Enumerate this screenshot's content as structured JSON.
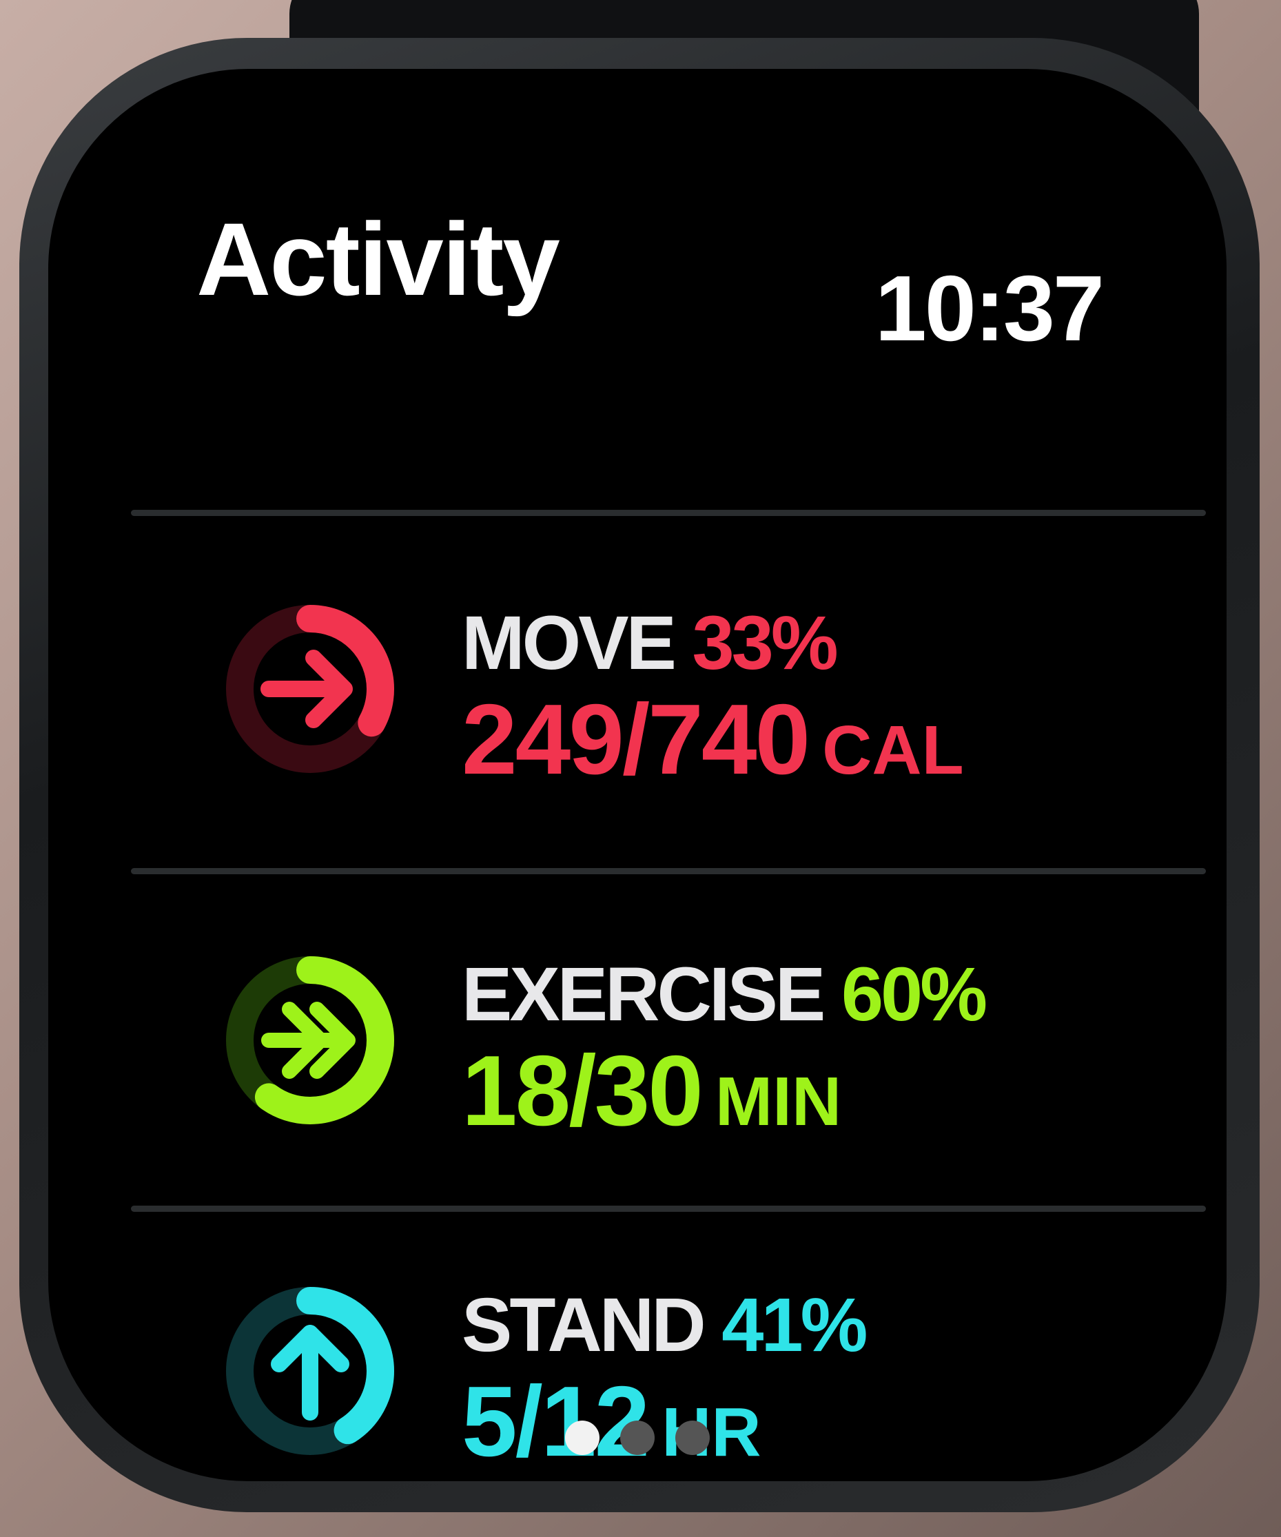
{
  "app": {
    "title": "Activity",
    "time": "10:37"
  },
  "rings": [
    {
      "name": "MOVE",
      "percent": "33%",
      "fraction": 0.33,
      "value": "249/740",
      "unit": "CAL",
      "color": "#f2344f",
      "track": "#3a0a12",
      "icon": "move-arrow-icon"
    },
    {
      "name": "EXERCISE",
      "percent": "60%",
      "fraction": 0.6,
      "value": "18/30",
      "unit": "MIN",
      "color": "#9ef21a",
      "track": "#1d3b06",
      "icon": "exercise-double-arrow-icon"
    },
    {
      "name": "STAND",
      "percent": "41%",
      "fraction": 0.41,
      "value": "5/12",
      "unit": "HR",
      "color": "#2fe3e8",
      "track": "#0c3437",
      "icon": "stand-up-arrow-icon"
    }
  ],
  "pages": {
    "count": 3,
    "current": 1
  }
}
